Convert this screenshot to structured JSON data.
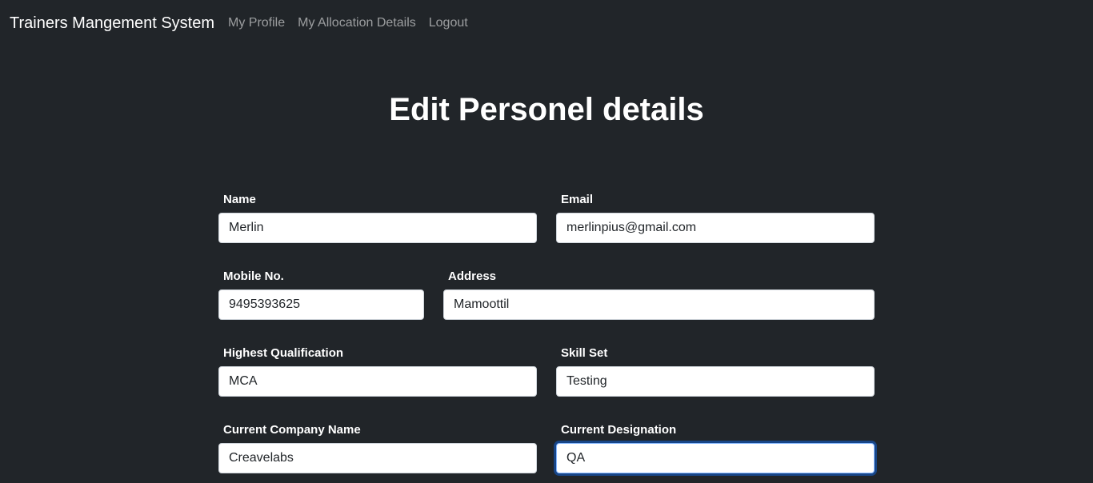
{
  "navbar": {
    "brand": "Trainers Mangement System",
    "links": [
      {
        "label": "My Profile"
      },
      {
        "label": "My Allocation Details"
      },
      {
        "label": "Logout"
      }
    ]
  },
  "page": {
    "title": "Edit Personel details"
  },
  "form": {
    "name": {
      "label": "Name",
      "value": "Merlin"
    },
    "email": {
      "label": "Email",
      "value": "merlinpius@gmail.com"
    },
    "mobile": {
      "label": "Mobile No.",
      "value": "9495393625"
    },
    "address": {
      "label": "Address",
      "value": "Mamoottil"
    },
    "qualification": {
      "label": "Highest Qualification",
      "value": "MCA"
    },
    "skillset": {
      "label": "Skill Set",
      "value": "Testing"
    },
    "company": {
      "label": "Current Company Name",
      "value": "Creavelabs"
    },
    "designation": {
      "label": "Current Designation",
      "value": "QA"
    }
  },
  "colors": {
    "background": "#212529",
    "nav_link": "rgba(255,255,255,0.55)",
    "focus_ring": "#86b7fe"
  }
}
